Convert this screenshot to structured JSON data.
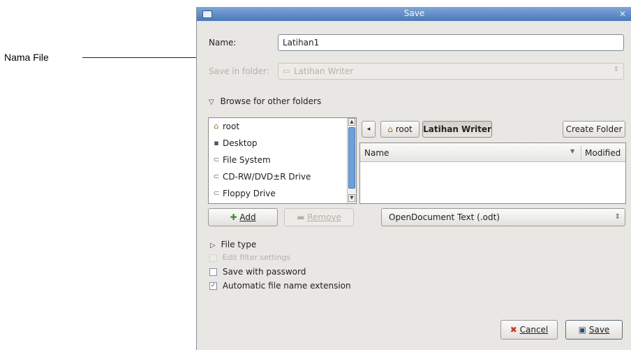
{
  "annotation": {
    "label": "Nama File"
  },
  "window": {
    "title": "Save",
    "close_glyph": "✕"
  },
  "name_field": {
    "label": "Name:",
    "value": "Latihan1"
  },
  "save_in_folder": {
    "label": "Save in folder:",
    "value": "Latihan Writer"
  },
  "browse_toggle": {
    "label": "Browse for other folders"
  },
  "places": {
    "items": [
      {
        "label": "root",
        "icon": "home-folder-icon"
      },
      {
        "label": "Desktop",
        "icon": "desktop-icon"
      },
      {
        "label": "File System",
        "icon": "harddisk-icon"
      },
      {
        "label": "CD-RW/DVD±R Drive",
        "icon": "optical-drive-icon"
      },
      {
        "label": "Floppy Drive",
        "icon": "floppy-icon"
      }
    ]
  },
  "path_bar": {
    "segments": [
      "root",
      "Latihan Writer"
    ],
    "active": "Latihan Writer"
  },
  "create_folder_button": {
    "label": "Create Folder"
  },
  "file_list": {
    "columns": [
      "Name",
      "Modified"
    ],
    "rows": []
  },
  "add_button": {
    "label": "Add"
  },
  "remove_button": {
    "label": "Remove"
  },
  "filter_select": {
    "value": "OpenDocument Text (.odt)"
  },
  "file_type_toggle": {
    "label": "File type"
  },
  "edit_filter_settings": {
    "label": "Edit filter settings"
  },
  "save_with_password": {
    "label": "Save with password",
    "checked": false
  },
  "auto_extension": {
    "label": "Automatic file name extension",
    "checked": true
  },
  "cancel_button": {
    "label": "Cancel"
  },
  "save_button": {
    "label": "Save"
  }
}
